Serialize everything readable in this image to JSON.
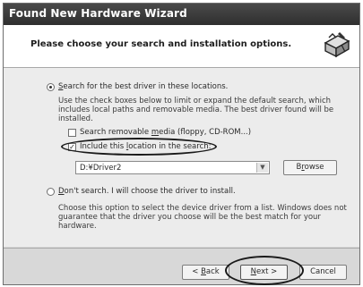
{
  "window": {
    "title": "Found New Hardware Wizard"
  },
  "header": {
    "text": "Please choose your search and installation options.",
    "icon": "hardware-install-icon"
  },
  "options": {
    "search_label_u": "S",
    "search_label_rest": "earch for the best driver in these locations.",
    "search_desc": "Use the check boxes below to limit or expand the default search, which includes local paths and removable media. The best driver found will be installed.",
    "removable_label_a": "Search removable ",
    "removable_label_u": "m",
    "removable_label_b": "edia (floppy, CD-ROM...)",
    "include_label_a": "Include this ",
    "include_label_u": "l",
    "include_label_b": "ocation in the search:",
    "include_checked": true,
    "location_value": "D:¥Driver2",
    "browse_u": "r",
    "browse_a": "B",
    "browse_b": "owse",
    "dont_label_u": "D",
    "dont_label_rest": "on't search. I will choose the driver to install.",
    "dont_desc": "Choose this option to select the device driver from a list. Windows does not guarantee that the driver you choose will be the best match for your hardware."
  },
  "buttons": {
    "back_a": "< ",
    "back_u": "B",
    "back_b": "ack",
    "next_u": "N",
    "next_b": "ext >",
    "cancel": "Cancel"
  }
}
